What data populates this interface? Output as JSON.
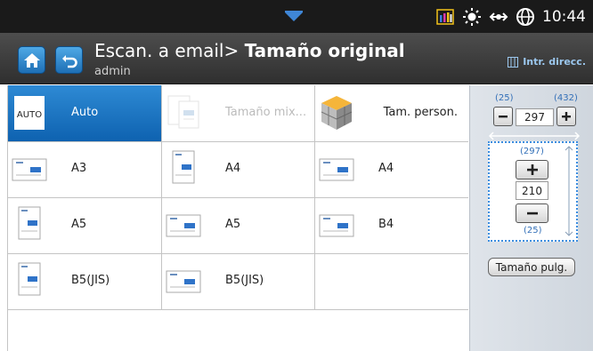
{
  "status": {
    "time": "10:44",
    "icons": [
      "pulldown-tab-icon",
      "toner-level-icon",
      "eco-brightness-icon",
      "network-icon",
      "globe-icon"
    ]
  },
  "header": {
    "title_prefix": "Escan. a email> ",
    "title_bold": "Tamaño original",
    "user": "admin",
    "direct_entry": "Intr. direcc."
  },
  "sizes": [
    {
      "label": "Auto",
      "icon_text": "AUTO",
      "state": "selected"
    },
    {
      "label": "Tamaño mix...",
      "state": "disabled"
    },
    {
      "label": "Tam. person.",
      "state": "normal"
    },
    {
      "label": "A3",
      "state": "normal"
    },
    {
      "label": "A4",
      "state": "normal"
    },
    {
      "label": "A4",
      "state": "normal"
    },
    {
      "label": "A5",
      "state": "normal"
    },
    {
      "label": "A5",
      "state": "normal"
    },
    {
      "label": "B4",
      "state": "normal"
    },
    {
      "label": "B5(JIS)",
      "state": "normal"
    },
    {
      "label": "B5(JIS)",
      "state": "normal"
    }
  ],
  "custom_size": {
    "width_min": "(25)",
    "width_max": "(432)",
    "width_value": "297",
    "height_max": "(297)",
    "height_value": "210",
    "height_min": "(25)",
    "inch_button": "Tamaño pulg."
  },
  "colors": {
    "selected": "#0e62b0",
    "accent": "#3370b8",
    "header": "#3a3a3a"
  }
}
